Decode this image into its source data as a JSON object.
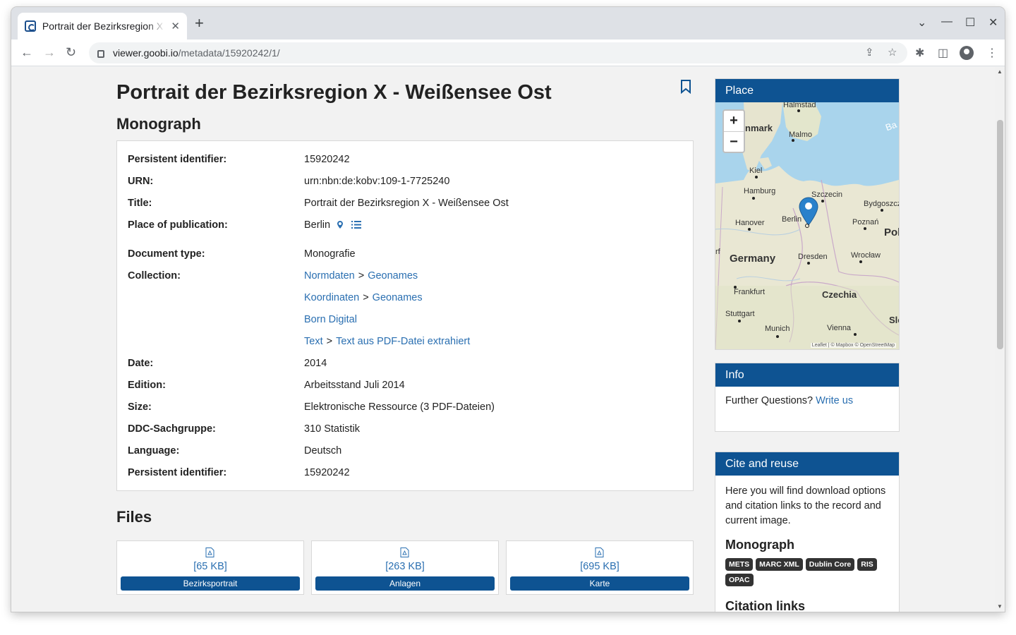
{
  "browser": {
    "tab_title": "Portrait der Bezirksregion X - Weißensee Ost",
    "tab_close": "✕",
    "new_tab": "+",
    "url_host": "viewer.goobi.io",
    "url_path": "/metadata/15920242/1/"
  },
  "page": {
    "title": "Portrait der Bezirksregion X - Weißensee Ost",
    "monograph_heading": "Monograph",
    "files_heading": "Files"
  },
  "metadata": {
    "persistent_id_label": "Persistent identifier:",
    "persistent_id_value": "15920242",
    "urn_label": "URN:",
    "urn_value": "urn:nbn:de:kobv:109-1-7725240",
    "title_label": "Title:",
    "title_value": "Portrait der Bezirksregion X - Weißensee Ost",
    "place_label": "Place of publication:",
    "place_value": "Berlin",
    "doctype_label": "Document type:",
    "doctype_value": "Monografie",
    "collection_label": "Collection:",
    "collections": [
      {
        "a": "Normdaten",
        "b": "Geonames"
      },
      {
        "a": "Koordinaten",
        "b": "Geonames"
      },
      {
        "a": "Born Digital"
      },
      {
        "a": "Text",
        "b": "Text aus PDF-Datei extrahiert"
      }
    ],
    "separator": ">",
    "date_label": "Date:",
    "date_value": "2014",
    "edition_label": "Edition:",
    "edition_value": "Arbeitsstand Juli 2014",
    "size_label": "Size:",
    "size_value": "Elektronische Ressource (3 PDF-Dateien)",
    "ddc_label": "DDC-Sachgruppe:",
    "ddc_value": "310 Statistik",
    "language_label": "Language:",
    "language_value": "Deutsch",
    "persistent_id2_label": "Persistent identifier:",
    "persistent_id2_value": "15920242"
  },
  "files": [
    {
      "size": "[65 KB]",
      "label": "Bezirksportrait"
    },
    {
      "size": "[263 KB]",
      "label": "Anlagen"
    },
    {
      "size": "[695 KB]",
      "label": "Karte"
    }
  ],
  "sidebar": {
    "place_heading": "Place",
    "map": {
      "zoom_in": "+",
      "zoom_out": "−",
      "attribution": "Leaflet | © Mapbox © OpenStreetMap",
      "labels": {
        "halmstad": "Halmstad",
        "denmark": "nmark",
        "malmo": "Malmo",
        "kiel": "Kiel",
        "hamburg": "Hamburg",
        "szczecin": "Szczecin",
        "bydgoszcz": "Bydgoszcz",
        "hanover": "Hanover",
        "berlin": "Berlin",
        "poznan": "Poznań",
        "poland": "Pol",
        "germany": "Germany",
        "dresden": "Dresden",
        "wroclaw": "Wrocław",
        "frankfurt": "Frankfurt",
        "czechia": "Czechia",
        "stuttgart": "Stuttgart",
        "munich": "Munich",
        "vienna": "Vienna",
        "slovakia": "Slo",
        "baltic": "Ba",
        "rf": "rf"
      }
    },
    "info_heading": "Info",
    "info_text": "Further Questions?",
    "info_link": "Write us",
    "cite_heading": "Cite and reuse",
    "cite_text": "Here you will find download options and citation links to the record and current image.",
    "cite_monograph": "Monograph",
    "badges": [
      "METS",
      "MARC XML",
      "Dublin Core",
      "RIS",
      "OPAC"
    ],
    "citation_links": "Citation links"
  },
  "colors": {
    "accent": "#0e5392",
    "link": "#2a6fb1"
  }
}
